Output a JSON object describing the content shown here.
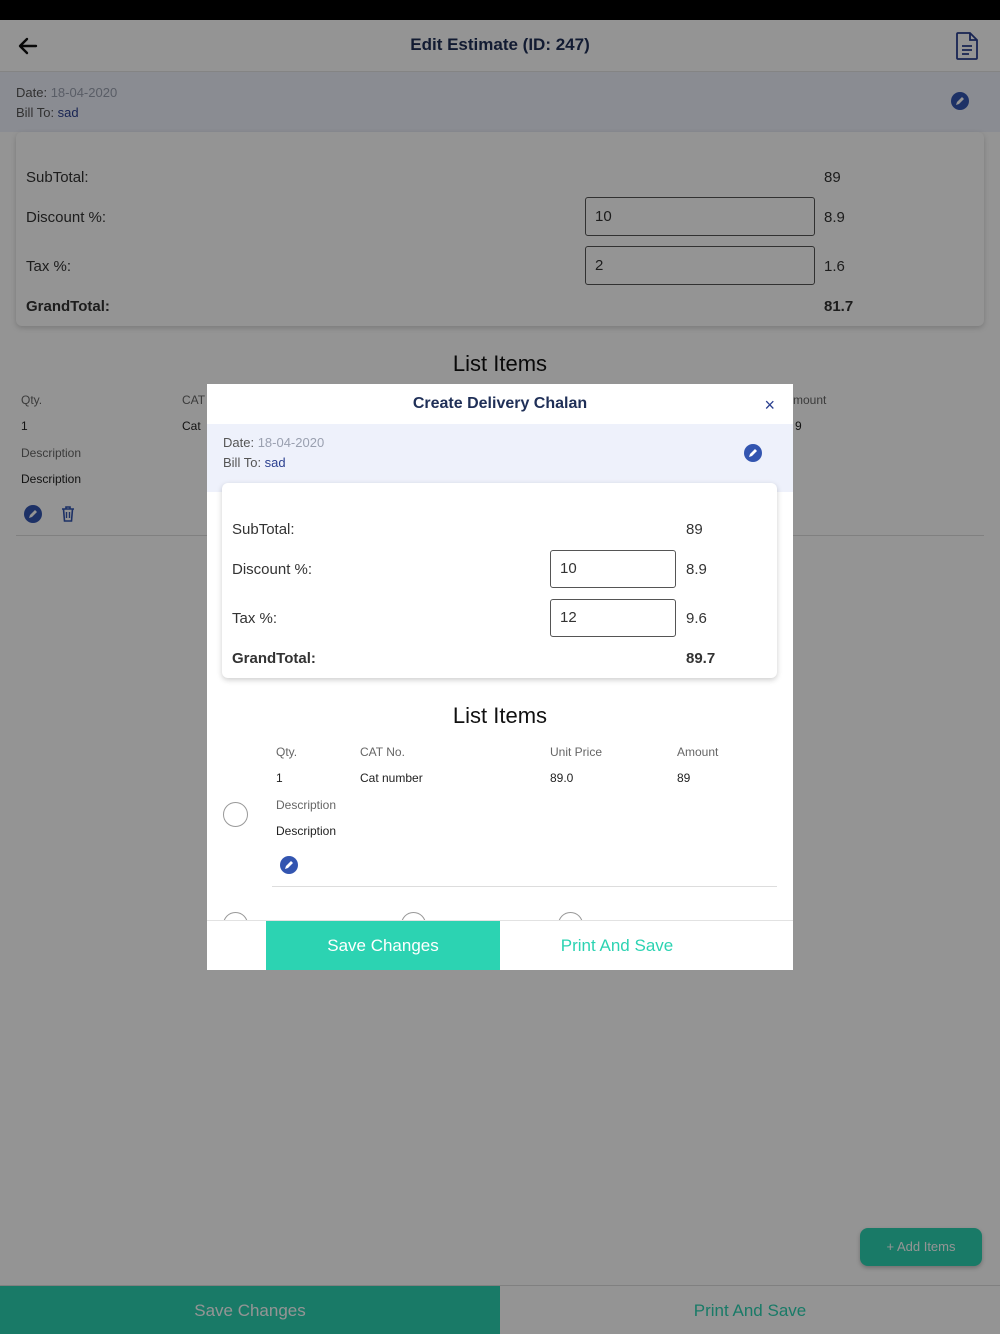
{
  "app": {
    "title": "Edit Estimate (ID: 247)",
    "back_icon": "arrow-left-icon",
    "doc_icon": "document-icon"
  },
  "bill": {
    "date_label": "Date: ",
    "date_value": "18-04-2020",
    "billto_label": "Bill To: ",
    "billto_value": "sad"
  },
  "summary": {
    "subtotal_label": "SubTotal:",
    "subtotal_value": "89",
    "discount_label": "Discount %:",
    "discount_input": "10",
    "discount_value": "8.9",
    "tax_label": "Tax %:",
    "tax_input": "2",
    "tax_value": "1.6",
    "grand_label": "GrandTotal:",
    "grand_value": "81.7"
  },
  "list": {
    "title": "List Items",
    "headers": {
      "qty": "Qty.",
      "cat": "CAT No.",
      "unit": "Unit Price",
      "amount": "Amount",
      "desc": "Description"
    },
    "item": {
      "qty": "1",
      "cat": "Cat number",
      "unit": "89.0",
      "amount": "89",
      "desc": "Description"
    }
  },
  "bg_partial": {
    "cat_header": "CAT",
    "cat_value": "Cat",
    "amount_header": "mount",
    "amount_value": "9"
  },
  "fab": {
    "label": "+ Add Items"
  },
  "footer": {
    "save": "Save Changes",
    "print": "Print And Save"
  },
  "modal": {
    "title": "Create Delivery Chalan",
    "close": "×",
    "bill": {
      "date_label": "Date: ",
      "date_value": "18-04-2020",
      "billto_label": "Bill To: ",
      "billto_value": "sad"
    },
    "summary": {
      "subtotal_label": "SubTotal:",
      "subtotal_value": "89",
      "discount_label": "Discount %:",
      "discount_input": "10",
      "discount_value": "8.9",
      "tax_label": "Tax %:",
      "tax_input": "12",
      "tax_value": "9.6",
      "grand_label": "GrandTotal:",
      "grand_value": "89.7"
    },
    "list_title": "List Items",
    "footer": {
      "save": "Save Changes",
      "print": "Print And Save"
    }
  },
  "colors": {
    "accent": "#2cd3b2",
    "navy": "#1f2f57",
    "edit_blue": "#3355b0"
  }
}
